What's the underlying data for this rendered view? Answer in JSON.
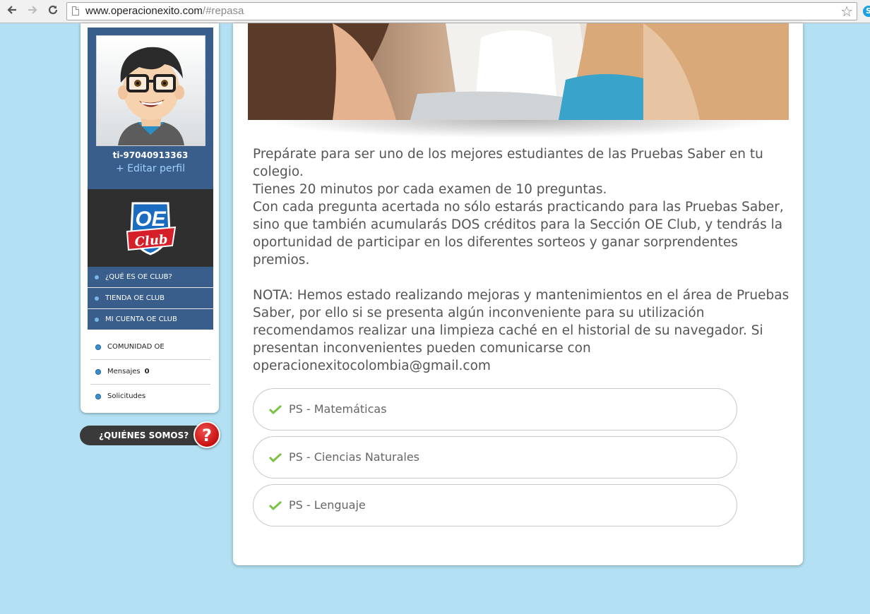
{
  "browser": {
    "url_host": "www.operacionexito.com",
    "url_path": "/#repasa",
    "back_icon": "arrow-left-icon",
    "forward_icon": "arrow-right-icon",
    "reload_icon": "reload-icon",
    "bookmark_icon": "star-icon",
    "extension_label": "S"
  },
  "sidebar": {
    "username": "ti-97040913363",
    "edit_profile": "+ Editar perfil",
    "club_menu": [
      {
        "label": "¿QUÉ ES OE CLUB?"
      },
      {
        "label": "TIENDA OE CLUB"
      },
      {
        "label": "MI CUENTA OE CLUB"
      }
    ],
    "links": [
      {
        "label": "COMUNIDAD OE"
      },
      {
        "label": "Mensajes",
        "count": "0"
      },
      {
        "label": "Solicitudes"
      }
    ],
    "about_label": "¿QUIÉNES SOMOS?",
    "about_badge": "?",
    "logo_text_top": "OE",
    "logo_text_bottom": "Club"
  },
  "main": {
    "intro": [
      "Prepárate para ser uno de los mejores estudiantes de las Pruebas Saber en tu colegio.",
      "Tienes 20 minutos por cada examen de 10 preguntas.",
      "Con cada pregunta acertada no sólo estarás practicando para las Pruebas Saber, sino que también acumularás DOS créditos para la Sección OE Club, y tendrás la oportunidad de participar en los diferentes sorteos y ganar sorprendentes premios."
    ],
    "note": "NOTA: Hemos estado realizando mejoras y mantenimientos en el área de Pruebas Saber, por ello si se presenta algún inconveniente para su utilización recomendamos realizar una limpieza caché en el historial de su navegador. Si presentan inconvenientes pueden comunicarse con operacionexitocolombia@gmail.com",
    "tests": [
      {
        "label": "PS - Matemáticas"
      },
      {
        "label": "PS - Ciencias Naturales"
      },
      {
        "label": "PS - Lenguaje"
      }
    ]
  },
  "colors": {
    "page_bg": "#b3e0f2",
    "sidebar_blue": "#3a5e8c",
    "check_green": "#7cc242"
  }
}
